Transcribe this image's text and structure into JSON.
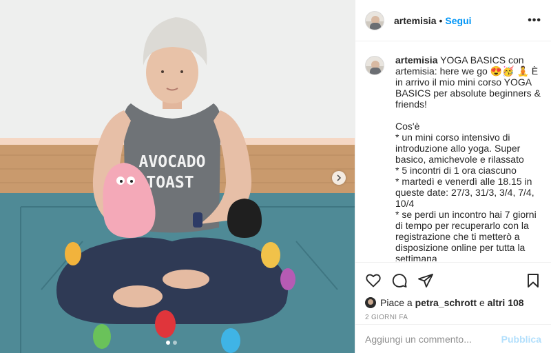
{
  "post": {
    "carousel": {
      "slide_count": 2,
      "active_slide": 1
    },
    "shirt_text": {
      "line1": "AVOCADO",
      "line2": "TOAST"
    }
  },
  "header": {
    "username": "artemisia",
    "separator": "•",
    "follow_label": "Segui",
    "more_label": "•••"
  },
  "caption": {
    "username": "artemisia",
    "text": "YOGA BASICS con artemisia: here we go 😍🥳 🧘 È in arrivo il mio mini corso YOGA BASICS per absolute beginners & friends!\n\nCos'è\n* un mini corso intensivo di introduzione allo yoga. Super basico, amichevole e rilassato\n* 5 incontri di 1 ora ciascuno\n* martedì e venerdì alle 18.15 in queste date: 27/3, 31/3, 3/4, 7/4, 10/4\n* se perdi un incontro hai 7 giorni di tempo per recuperarlo con la registrazione che ti metterò a disposizione online per tutta la settimana\n* useremo la piattaforma Zoom che"
  },
  "actions": {
    "like_icon": "heart-icon",
    "comment_icon": "comment-icon",
    "share_icon": "share-icon",
    "save_icon": "bookmark-icon"
  },
  "likes": {
    "prefix": "Piace a",
    "user": "petra_schrott",
    "conjunction": "e",
    "others": "altri 108"
  },
  "timestamp": "2 GIORNI FA",
  "comment_input": {
    "placeholder": "Aggiungi un commento...",
    "value": "",
    "post_label": "Pubblica"
  },
  "colors": {
    "accent_blue": "#0095f6",
    "post_disabled": "#b2dffc",
    "mat_teal": "#4f8a96"
  }
}
